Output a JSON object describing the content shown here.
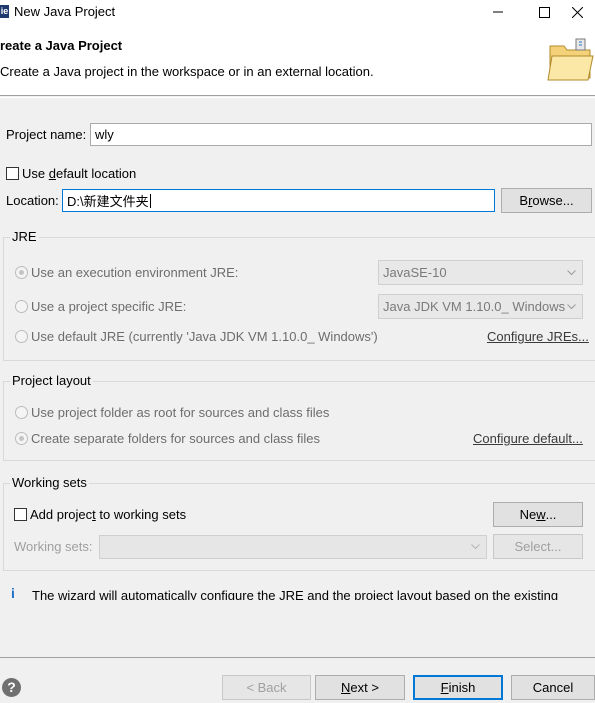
{
  "window": {
    "title": "New Java Project",
    "app_icon_glyph": "ie"
  },
  "header": {
    "title": "reate a Java Project",
    "description": "Create a Java project in the workspace or in an external location."
  },
  "project_name": {
    "label": "Project name:",
    "value": "wly"
  },
  "default_location": {
    "label_pre": "Use ",
    "label_mn": "d",
    "label_post": "efault location",
    "checked": false
  },
  "location": {
    "label": "Location:",
    "value": "D:\\新建文件夹",
    "browse_pre": "B",
    "browse_mn": "r",
    "browse_post": "owse..."
  },
  "jre": {
    "title": "JRE",
    "option_env": "Use an execution environment JRE:",
    "env_value": "JavaSE-10",
    "option_specific": "Use a project specific JRE:",
    "specific_value": "Java JDK VM 1.10.0_ Windows",
    "option_default": "Use default JRE (currently 'Java JDK VM 1.10.0_ Windows')",
    "configure_link": "Configure JREs..."
  },
  "project_layout": {
    "title": "Project layout",
    "option_root": "Use project folder as root for sources and class files",
    "option_separate": "Create separate folders for sources and class files",
    "configure_link": "Configure default..."
  },
  "working_sets": {
    "title": "Working sets",
    "add_label_pre": "Add projec",
    "add_label_mn": "t",
    "add_label_post": " to working sets",
    "new_pre": "Ne",
    "new_mn": "w",
    "new_post": "...",
    "sets_label": "Working sets:",
    "select_label": "Select..."
  },
  "info": {
    "icon": "info-icon",
    "text": "The wizard will automatically configure the JRE and the project layout based on the existing"
  },
  "footer": {
    "back_label": "< Back",
    "next_pre": "",
    "next_mn": "N",
    "next_post": "ext >",
    "finish_pre": "",
    "finish_mn": "F",
    "finish_post": "inish",
    "cancel_label": "Cancel"
  },
  "colors": {
    "accent": "#0078d7",
    "info_blue": "#1e73c8"
  }
}
